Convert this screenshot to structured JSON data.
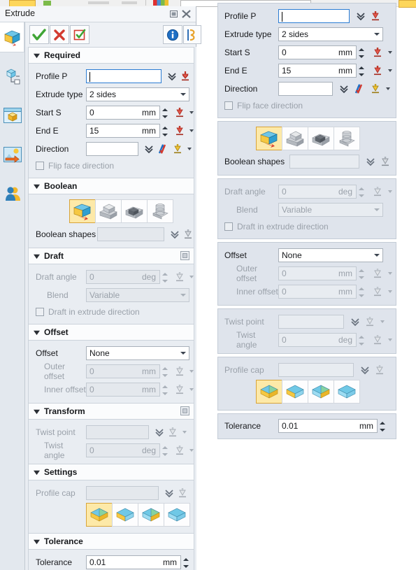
{
  "window": {
    "title": "Extrude",
    "restore_tooltip": "Restore",
    "close_tooltip": "Close"
  },
  "toolbar": {
    "ok_label": "OK",
    "cancel_label": "Cancel",
    "apply_label": "Apply",
    "info_label": "Info",
    "help_label": "Help"
  },
  "rail": {
    "items": [
      {
        "name": "extrude-tool-icon",
        "label": "Extrude"
      },
      {
        "name": "structure-tree-icon",
        "label": "Structure"
      },
      {
        "name": "part-display-icon",
        "label": "Display"
      },
      {
        "name": "scene-image-icon",
        "label": "Scene"
      },
      {
        "name": "user-icon",
        "label": "User"
      }
    ]
  },
  "sections": {
    "required": {
      "title": "Required",
      "fields": {
        "profile_label": "Profile P",
        "profile_value": "",
        "extrude_type_label": "Extrude type",
        "extrude_type_value": "2 sides",
        "start_label": "Start S",
        "start_value": "0",
        "start_unit": "mm",
        "end_label": "End E",
        "end_value": "15",
        "end_unit": "mm",
        "direction_label": "Direction",
        "direction_value": "",
        "flip_face_label": "Flip face direction"
      }
    },
    "boolean": {
      "title": "Boolean",
      "shapes_label": "Boolean shapes",
      "shapes_value": "",
      "modes": [
        {
          "name": "boolean-create-icon",
          "label": "Create",
          "selected": true
        },
        {
          "name": "boolean-add-icon",
          "label": "Add",
          "selected": false
        },
        {
          "name": "boolean-subtract-icon",
          "label": "Subtract",
          "selected": false
        },
        {
          "name": "boolean-intersect-icon",
          "label": "Intersect",
          "selected": false
        }
      ]
    },
    "draft": {
      "title": "Draft",
      "angle_label": "Draft angle",
      "angle_value": "0",
      "angle_unit": "deg",
      "blend_label": "Blend",
      "blend_value": "Variable",
      "extrude_dir_label": "Draft in extrude direction"
    },
    "offset": {
      "title": "Offset",
      "offset_label": "Offset",
      "offset_value": "None",
      "outer_label": "Outer offset",
      "outer_value": "0",
      "outer_unit": "mm",
      "inner_label": "Inner offset",
      "inner_value": "0",
      "inner_unit": "mm"
    },
    "transform": {
      "title": "Transform",
      "twist_point_label": "Twist point",
      "twist_point_value": "",
      "twist_angle_label": "Twist angle",
      "twist_angle_value": "0",
      "twist_angle_unit": "deg"
    },
    "settings": {
      "title": "Settings",
      "profile_cap_label": "Profile cap",
      "profile_cap_value": "",
      "caps": [
        {
          "name": "cap-both-icon",
          "label": "Cap both ends",
          "selected": true
        },
        {
          "name": "cap-start-icon",
          "label": "Cap start",
          "selected": false
        },
        {
          "name": "cap-end-icon",
          "label": "Cap end",
          "selected": false
        },
        {
          "name": "cap-none-icon",
          "label": "No cap",
          "selected": false
        }
      ]
    },
    "tolerance": {
      "title": "Tolerance",
      "tolerance_label": "Tolerance",
      "tolerance_value": "0.01",
      "tolerance_unit": "mm"
    }
  },
  "colors": {
    "accent_blue": "#2b7cd3",
    "selected_yellow": "#fde9a8",
    "selected_border": "#d8a43a",
    "panel_bg": "#e9edf2",
    "group_bg": "#dfe4ec",
    "field_border": "#a9b1ba",
    "disabled_text": "#9aa1aa",
    "ok_green": "#3fa535",
    "cancel_red": "#d33b30",
    "info_blue": "#1f6fc4"
  }
}
